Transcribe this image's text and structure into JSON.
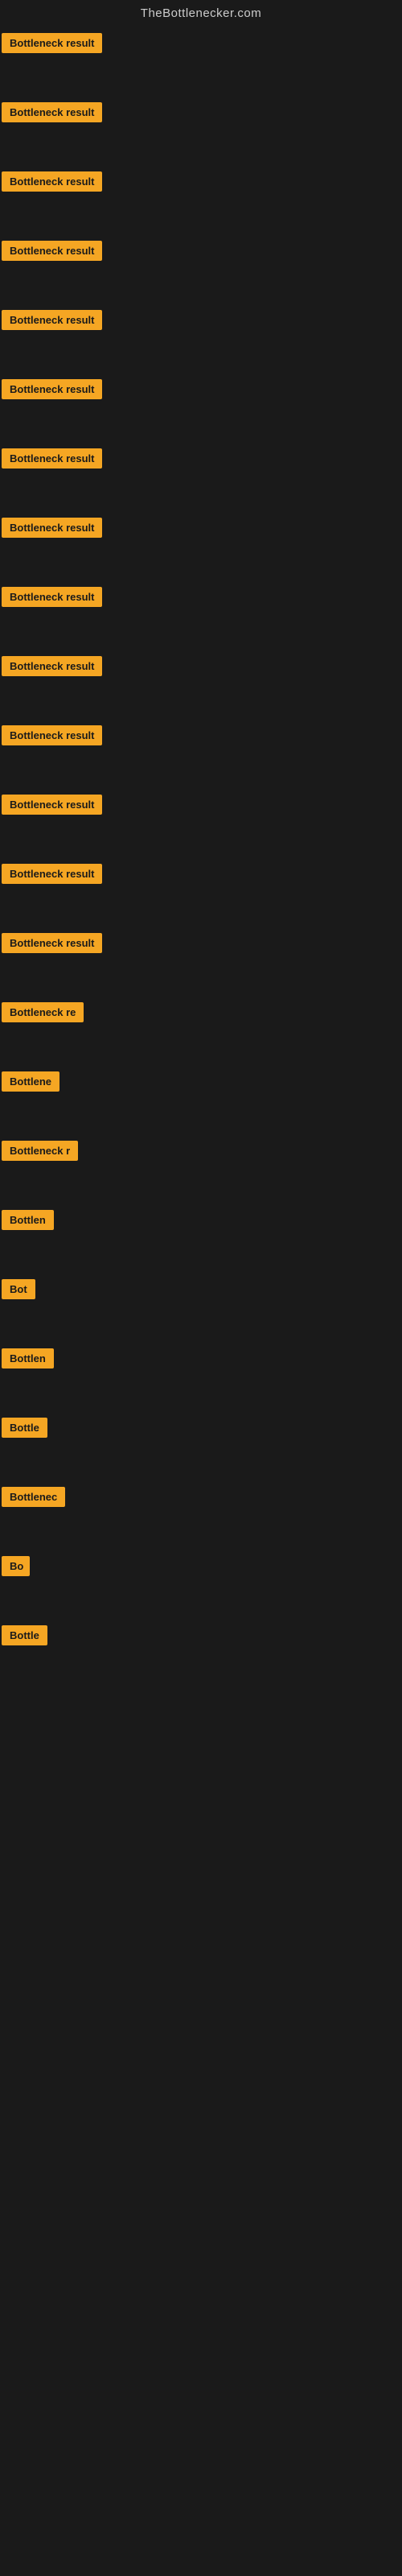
{
  "header": {
    "title": "TheBottlenecker.com"
  },
  "items": [
    {
      "id": 1,
      "label": "Bottleneck result"
    },
    {
      "id": 2,
      "label": "Bottleneck result"
    },
    {
      "id": 3,
      "label": "Bottleneck result"
    },
    {
      "id": 4,
      "label": "Bottleneck result"
    },
    {
      "id": 5,
      "label": "Bottleneck result"
    },
    {
      "id": 6,
      "label": "Bottleneck result"
    },
    {
      "id": 7,
      "label": "Bottleneck result"
    },
    {
      "id": 8,
      "label": "Bottleneck result"
    },
    {
      "id": 9,
      "label": "Bottleneck result"
    },
    {
      "id": 10,
      "label": "Bottleneck result"
    },
    {
      "id": 11,
      "label": "Bottleneck result"
    },
    {
      "id": 12,
      "label": "Bottleneck result"
    },
    {
      "id": 13,
      "label": "Bottleneck result"
    },
    {
      "id": 14,
      "label": "Bottleneck result"
    },
    {
      "id": 15,
      "label": "Bottleneck re"
    },
    {
      "id": 16,
      "label": "Bottlene"
    },
    {
      "id": 17,
      "label": "Bottleneck r"
    },
    {
      "id": 18,
      "label": "Bottlen"
    },
    {
      "id": 19,
      "label": "Bot"
    },
    {
      "id": 20,
      "label": "Bottlen"
    },
    {
      "id": 21,
      "label": "Bottle"
    },
    {
      "id": 22,
      "label": "Bottlenec"
    },
    {
      "id": 23,
      "label": "Bo"
    },
    {
      "id": 24,
      "label": "Bottle"
    }
  ]
}
